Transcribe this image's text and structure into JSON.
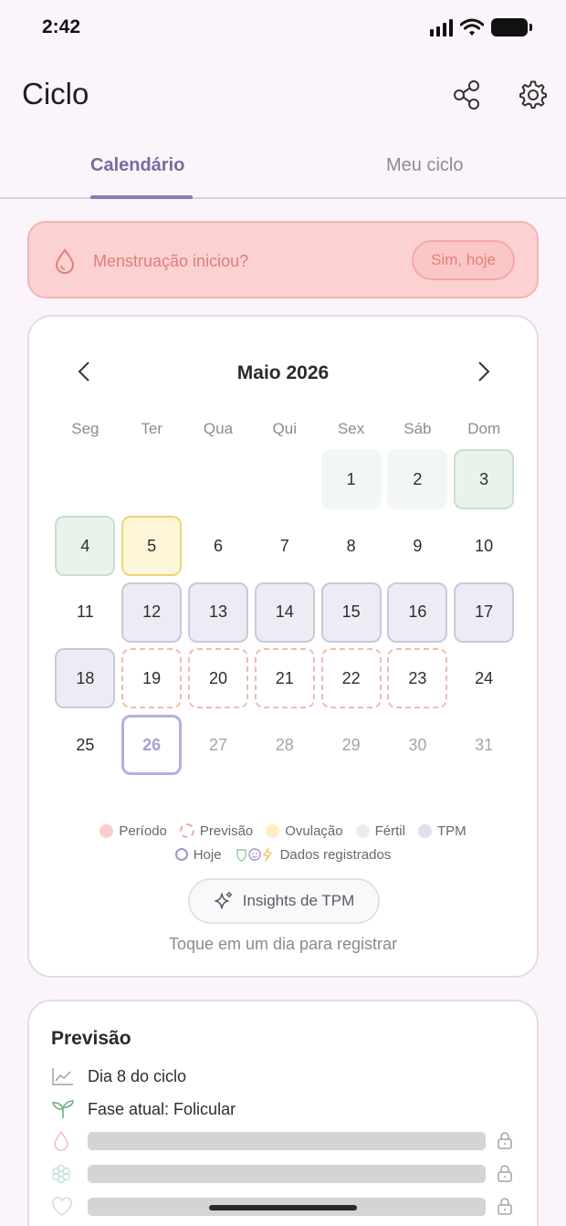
{
  "status": {
    "time": "2:42"
  },
  "header": {
    "title": "Ciclo",
    "share_icon": "share-icon",
    "settings_icon": "gear-icon"
  },
  "tabs": [
    {
      "label": "Calendário",
      "active": true
    },
    {
      "label": "Meu ciclo",
      "active": false
    }
  ],
  "alert": {
    "text": "Menstruação iniciou?",
    "button": "Sim, hoje",
    "icon": "drop-icon"
  },
  "calendar": {
    "month": "Maio 2026",
    "weekdays": [
      "Seg",
      "Ter",
      "Qua",
      "Qui",
      "Sex",
      "Sáb",
      "Dom"
    ],
    "days": [
      {
        "n": "",
        "t": "empty"
      },
      {
        "n": "",
        "t": "empty"
      },
      {
        "n": "",
        "t": "empty"
      },
      {
        "n": "",
        "t": "empty"
      },
      {
        "n": "1",
        "t": "fertile"
      },
      {
        "n": "2",
        "t": "fertile"
      },
      {
        "n": "3",
        "t": "fertile-strong"
      },
      {
        "n": "4",
        "t": "fertile-strong"
      },
      {
        "n": "5",
        "t": "ovulation"
      },
      {
        "n": "6",
        "t": ""
      },
      {
        "n": "7",
        "t": ""
      },
      {
        "n": "8",
        "t": ""
      },
      {
        "n": "9",
        "t": ""
      },
      {
        "n": "10",
        "t": ""
      },
      {
        "n": "11",
        "t": ""
      },
      {
        "n": "12",
        "t": "tpm"
      },
      {
        "n": "13",
        "t": "tpm"
      },
      {
        "n": "14",
        "t": "tpm"
      },
      {
        "n": "15",
        "t": "tpm"
      },
      {
        "n": "16",
        "t": "tpm"
      },
      {
        "n": "17",
        "t": "tpm"
      },
      {
        "n": "18",
        "t": "tpm"
      },
      {
        "n": "19",
        "t": "forecast"
      },
      {
        "n": "20",
        "t": "forecast"
      },
      {
        "n": "21",
        "t": "forecast"
      },
      {
        "n": "22",
        "t": "forecast"
      },
      {
        "n": "23",
        "t": "forecast"
      },
      {
        "n": "24",
        "t": ""
      },
      {
        "n": "25",
        "t": ""
      },
      {
        "n": "26",
        "t": "today"
      },
      {
        "n": "27",
        "t": "future"
      },
      {
        "n": "28",
        "t": "future"
      },
      {
        "n": "29",
        "t": "future"
      },
      {
        "n": "30",
        "t": "future"
      },
      {
        "n": "31",
        "t": "future"
      }
    ],
    "legend": {
      "period": "Período",
      "forecast": "Previsão",
      "ovulation": "Ovulação",
      "fertile": "Fértil",
      "tpm": "TPM",
      "today": "Hoje",
      "logged": "Dados registrados"
    },
    "insights_button": "Insights de TPM",
    "hint": "Toque em um dia para registrar"
  },
  "forecast": {
    "title": "Previsão",
    "cycle_day": "Dia 8 do ciclo",
    "phase": "Fase atual: Folicular"
  },
  "colors": {
    "accent": "#7b6a9f",
    "alert_bg": "#fbd1d1",
    "alert_text": "#e07e7a",
    "period": "#f8cfcf",
    "ovulation": "#fbeec2",
    "fertile": "#e8ecea",
    "tpm": "#e2e0ee"
  }
}
